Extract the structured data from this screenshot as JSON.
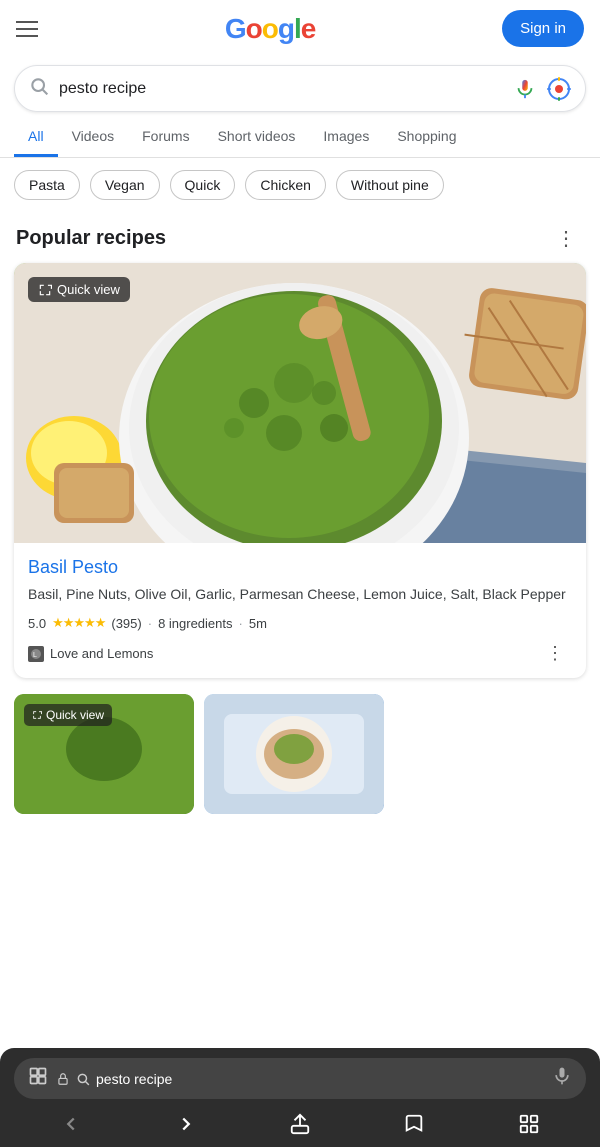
{
  "header": {
    "menu_label": "Menu",
    "logo_text": "Google",
    "logo_parts": [
      {
        "char": "G",
        "color": "blue"
      },
      {
        "char": "o",
        "color": "red"
      },
      {
        "char": "o",
        "color": "yellow"
      },
      {
        "char": "g",
        "color": "blue"
      },
      {
        "char": "l",
        "color": "green"
      },
      {
        "char": "e",
        "color": "red"
      }
    ],
    "signin_label": "Sign in"
  },
  "search": {
    "query": "pesto recipe",
    "placeholder": "Search",
    "mic_title": "Search by voice",
    "lens_title": "Search by image"
  },
  "tabs": [
    {
      "label": "All",
      "active": true
    },
    {
      "label": "Videos",
      "active": false
    },
    {
      "label": "Forums",
      "active": false
    },
    {
      "label": "Short videos",
      "active": false
    },
    {
      "label": "Images",
      "active": false
    },
    {
      "label": "Shopping",
      "active": false
    }
  ],
  "filter_chips": [
    {
      "label": "Pasta"
    },
    {
      "label": "Vegan"
    },
    {
      "label": "Quick"
    },
    {
      "label": "Chicken"
    },
    {
      "label": "Without pine"
    }
  ],
  "popular_recipes": {
    "section_title": "Popular recipes",
    "more_options_label": "More options"
  },
  "recipe_card": {
    "quick_view_label": "Quick view",
    "title": "Basil Pesto",
    "ingredients": "Basil, Pine Nuts, Olive Oil, Garlic, Parmesan Cheese, Lemon Juice, Salt, Black Pepper",
    "rating": "5.0",
    "reviews": "(395)",
    "ingredients_count": "8 ingredients",
    "time": "5m",
    "source": "Love and Lemons"
  },
  "browser_bar": {
    "search_query": "pesto recipe",
    "lock_icon_title": "Secure",
    "mic_title": "Voice search",
    "tabs_icon_title": "Tabs",
    "back_label": "Back",
    "forward_label": "Forward",
    "share_label": "Share",
    "bookmarks_label": "Bookmarks",
    "windows_label": "Windows"
  },
  "colors": {
    "google_blue": "#4285F4",
    "google_red": "#EA4335",
    "google_yellow": "#FBBC05",
    "google_green": "#34A853",
    "link_blue": "#1a73e8",
    "star_gold": "#fbbc05"
  }
}
